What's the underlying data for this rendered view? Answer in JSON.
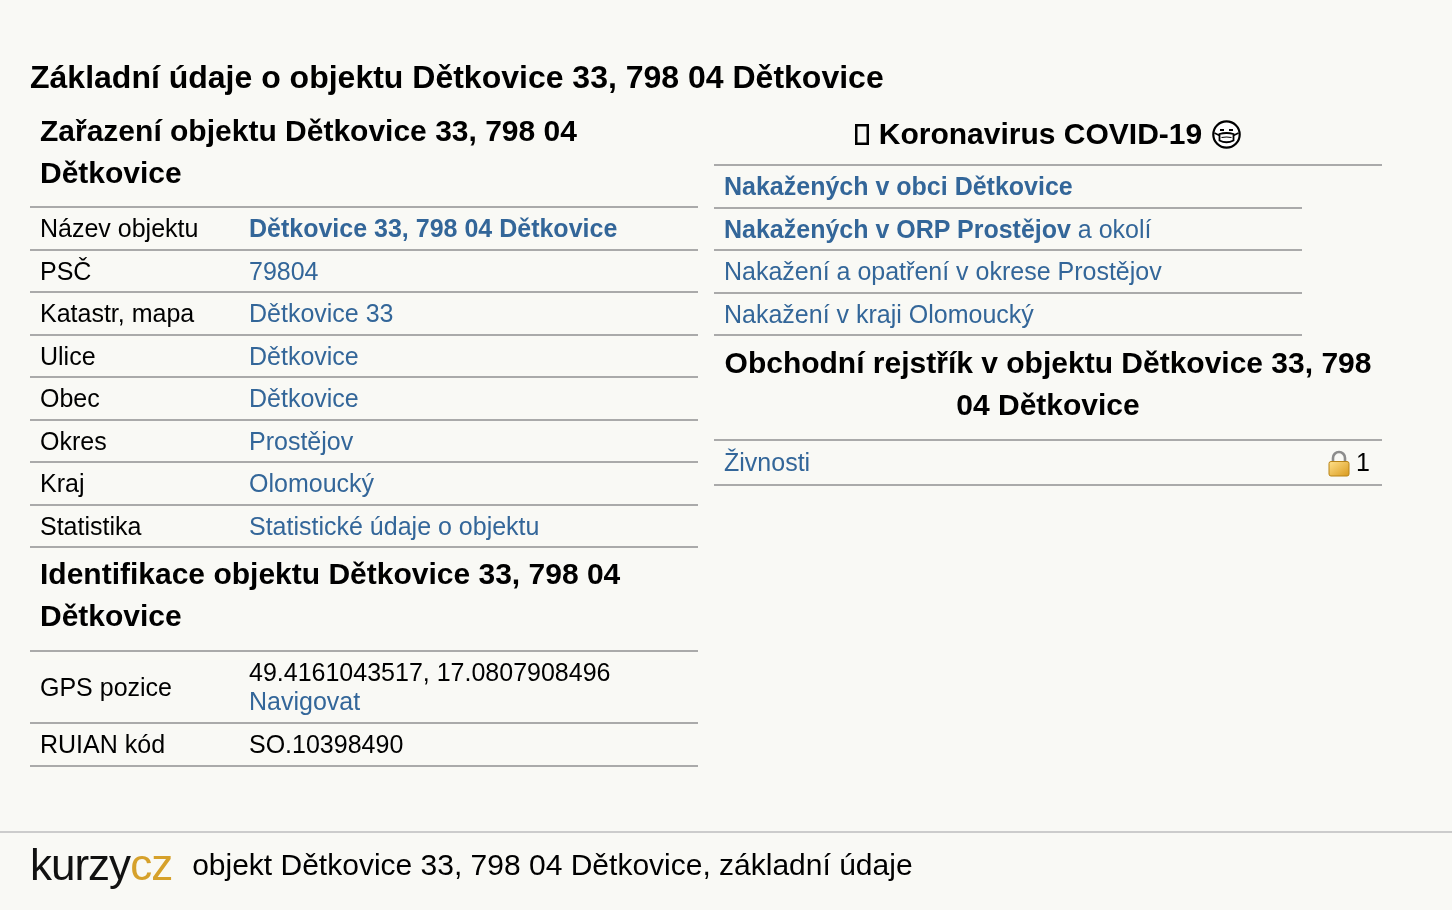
{
  "page_title": "Základní údaje o objektu Dětkovice 33, 798 04 Dětkovice",
  "classification": {
    "heading": "Zařazení objektu Dětkovice 33, 798 04 Dětkovice",
    "rows": [
      {
        "label": "Název objektu",
        "value": "Dětkovice 33, 798 04 Dětkovice",
        "bold": true
      },
      {
        "label": "PSČ",
        "value": "79804",
        "bold": false
      },
      {
        "label": "Katastr, mapa",
        "value": "Dětkovice 33",
        "bold": false
      },
      {
        "label": "Ulice",
        "value": "Dětkovice",
        "bold": false
      },
      {
        "label": "Obec",
        "value": "Dětkovice",
        "bold": false
      },
      {
        "label": "Okres",
        "value": "Prostějov",
        "bold": false
      },
      {
        "label": "Kraj",
        "value": "Olomoucký",
        "bold": false
      },
      {
        "label": "Statistika",
        "value": "Statistické údaje o objektu",
        "bold": false
      }
    ]
  },
  "identification": {
    "heading": "Identifikace objektu Dětkovice 33, 798 04 Dětkovice",
    "rows": [
      {
        "label": "GPS pozice",
        "value": "49.4161043517, 17.0807908496",
        "link": "Navigovat"
      },
      {
        "label": "RUIAN kód",
        "value": "SO.10398490"
      }
    ]
  },
  "covid": {
    "heading": "Koronavirus COVID-19",
    "links": [
      {
        "text": "Nakažených v obci Dětkovice",
        "bold": true
      },
      {
        "text": "**Nakažených v ORP Prostějov** a okolí",
        "bold": false
      },
      {
        "text": "Nakažení a opatření v okrese Prostějov",
        "bold": false
      },
      {
        "text": "Nakažení v kraji Olomoucký",
        "bold": false
      }
    ]
  },
  "business_register": {
    "heading": "Obchodní rejstřík v objektu Dětkovice 33, 798 04 Dětkovice",
    "rows": [
      {
        "label": "Živnosti",
        "count": "1"
      }
    ]
  },
  "footer": {
    "logo": {
      "prefix": "kurzy",
      "suffix": "cz"
    },
    "caption": "objekt Dětkovice 33, 798 04 Dětkovice, základní údaje"
  }
}
